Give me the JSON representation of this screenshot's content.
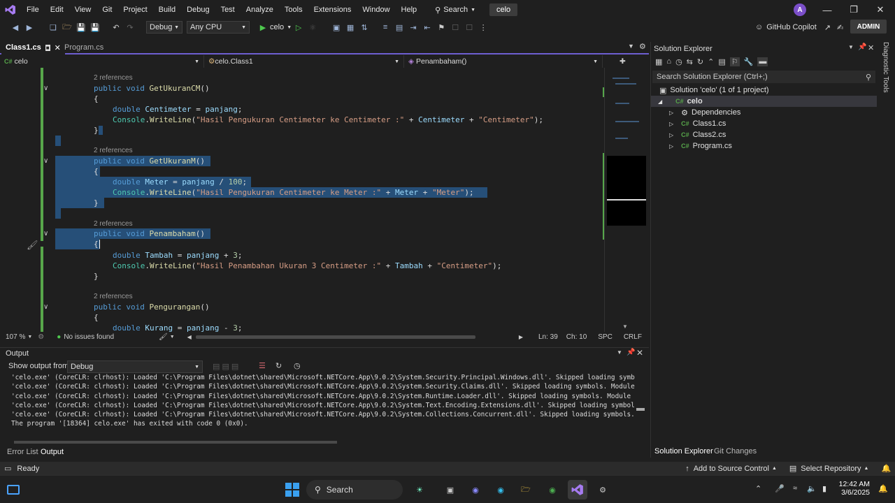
{
  "menu": {
    "items": [
      "File",
      "Edit",
      "View",
      "Git",
      "Project",
      "Build",
      "Debug",
      "Test",
      "Analyze",
      "Tools",
      "Extensions",
      "Window",
      "Help"
    ],
    "search_label": "Search",
    "project_name": "celo",
    "avatar_letter": "A"
  },
  "toolbar": {
    "config": "Debug",
    "platform": "Any CPU",
    "run_target": "celo",
    "copilot": "GitHub Copilot",
    "admin": "ADMIN"
  },
  "tabs": [
    {
      "label": "Class1.cs",
      "active": true
    },
    {
      "label": "Program.cs",
      "active": false
    }
  ],
  "navbar": {
    "project": "celo",
    "class": "celo.Class1",
    "member": "Penambaham()"
  },
  "code": {
    "refs": "2 references",
    "m1_sig": "GetUkuranCM",
    "m1_var": "Centimeter",
    "m1_str1": "\"Hasil Pengukuran Centimeter ke Centimeter :\"",
    "m1_str2": "\"Centimeter\"",
    "m2_sig": "GetUkuranM",
    "m2_var": "Meter",
    "m2_num": "100",
    "m2_str1": "\"Hasil Pengukuran Centimeter ke Meter :\"",
    "m2_str2": "\"Meter\"",
    "m3_sig": "Penambaham",
    "m3_var": "Tambah",
    "m3_num": "3",
    "m3_str1": "\"Hasil Penambahan Ukuran 3 Centimeter :\"",
    "m3_str2": "\"Centimeter\"",
    "m4_sig": "Pengurangan",
    "m4_var": "Kurang",
    "m4_num": "3",
    "kw_public": "public",
    "kw_void": "void",
    "kw_double": "double",
    "ty_console": "Console",
    "fn_writeline": "WriteLine",
    "var_panjang": "panjang"
  },
  "editor_status": {
    "zoom": "107 %",
    "issues": "No issues found",
    "line": "Ln: 39",
    "col": "Ch: 10",
    "spc": "SPC",
    "eol": "CRLF"
  },
  "output": {
    "title": "Output",
    "show_from_label": "Show output from:",
    "source": "Debug",
    "lines": [
      "'celo.exe' (CoreCLR: clrhost): Loaded 'C:\\Program Files\\dotnet\\shared\\Microsoft.NETCore.App\\9.0.2\\System.Security.Principal.Windows.dll'. Skipped loading symbols. Modu",
      "'celo.exe' (CoreCLR: clrhost): Loaded 'C:\\Program Files\\dotnet\\shared\\Microsoft.NETCore.App\\9.0.2\\System.Security.Claims.dll'. Skipped loading symbols. Module is optim",
      "'celo.exe' (CoreCLR: clrhost): Loaded 'C:\\Program Files\\dotnet\\shared\\Microsoft.NETCore.App\\9.0.2\\System.Runtime.Loader.dll'. Skipped loading symbols. Module is optimi",
      "'celo.exe' (CoreCLR: clrhost): Loaded 'C:\\Program Files\\dotnet\\shared\\Microsoft.NETCore.App\\9.0.2\\System.Text.Encoding.Extensions.dll'. Skipped loading symbols. Module",
      "'celo.exe' (CoreCLR: clrhost): Loaded 'C:\\Program Files\\dotnet\\shared\\Microsoft.NETCore.App\\9.0.2\\System.Collections.Concurrent.dll'. Skipped loading symbols. Module is",
      "The program '[18364] celo.exe' has exited with code 0 (0x0)."
    ],
    "tab_errors": "Error List",
    "tab_output": "Output"
  },
  "solution_explorer": {
    "title": "Solution Explorer",
    "search_placeholder": "Search Solution Explorer (Ctrl+;)",
    "solution": "Solution 'celo' (1 of 1 project)",
    "project": "celo",
    "items": [
      "Dependencies",
      "Class1.cs",
      "Class2.cs",
      "Program.cs"
    ],
    "tab_se": "Solution Explorer",
    "tab_git": "Git Changes"
  },
  "diagnostic_tools": "Diagnostic Tools",
  "statusbar": {
    "ready": "Ready",
    "source_control": "Add to Source Control",
    "repo": "Select Repository"
  },
  "taskbar": {
    "search": "Search",
    "time": "12:42 AM",
    "date": "3/6/2025"
  },
  "colors": {
    "accent": "#6d5fd1",
    "selection": "#264f78",
    "change_bar": "#57a64a"
  }
}
